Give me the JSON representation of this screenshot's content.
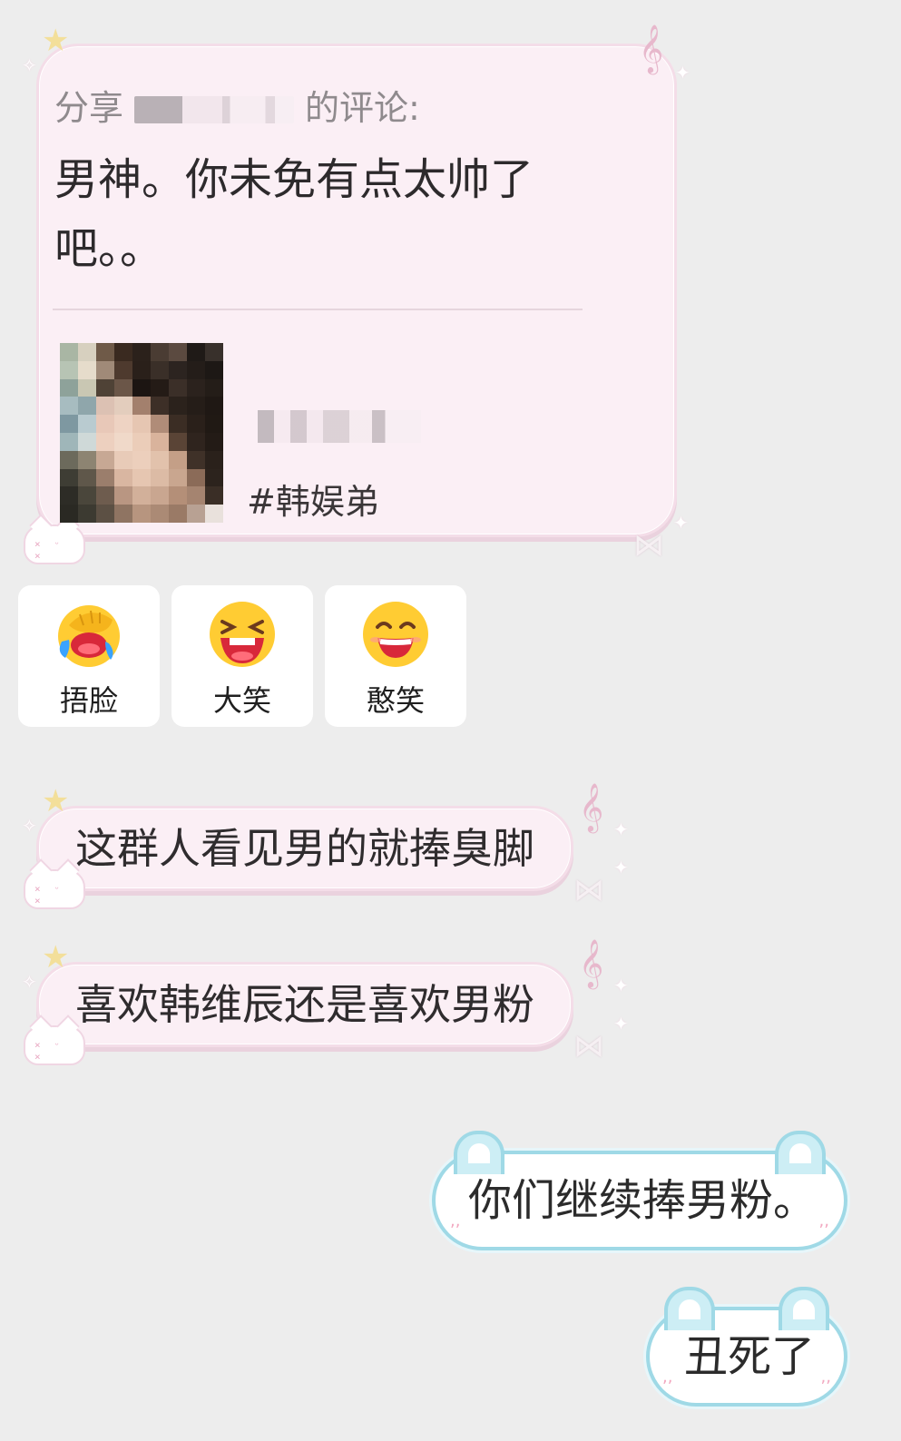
{
  "share_card": {
    "prefix": "分享",
    "suffix": "的评论:",
    "comment": "男神。你未免有点太帅了吧。。",
    "tag": "#韩娱弟"
  },
  "reactions": [
    {
      "icon": "facepalm-emoji-icon",
      "label": "捂脸"
    },
    {
      "icon": "laughing-emoji-icon",
      "label": "大笑"
    },
    {
      "icon": "grin-emoji-icon",
      "label": "憨笑"
    }
  ],
  "messages_in": [
    {
      "text": "这群人看见男的就捧臭脚"
    },
    {
      "text": "喜欢韩维辰还是喜欢男粉"
    }
  ],
  "messages_out": [
    {
      "text": "你们继续捧男粉。"
    },
    {
      "text": "丑死了"
    }
  ],
  "colors": {
    "background": "#ededed",
    "incoming_bubble": "#fbeff5",
    "outgoing_border": "#9fd9e6"
  }
}
